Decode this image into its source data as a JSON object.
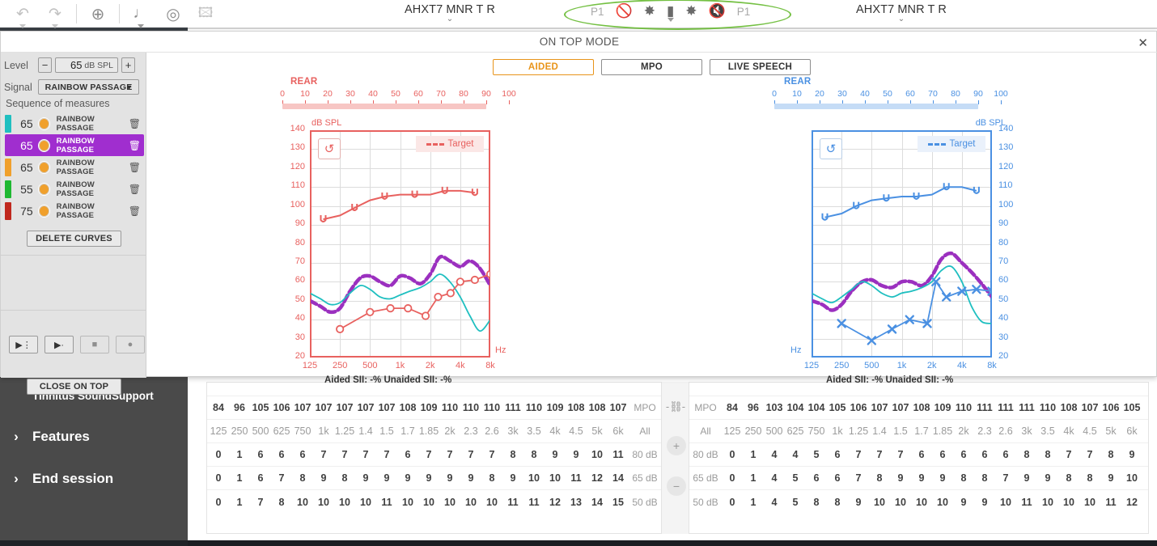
{
  "toolbar": {
    "icons": [
      {
        "name": "undo-icon",
        "glyph": "↶",
        "dim": true,
        "caret": true
      },
      {
        "name": "redo-icon",
        "glyph": "↷",
        "dim": true,
        "caret": true
      },
      {
        "name": "target-icon",
        "glyph": "⊕",
        "dim": false,
        "caret": false
      },
      {
        "name": "music-note-icon",
        "glyph": "♪",
        "dim": false,
        "caret": true
      },
      {
        "name": "spiral-target-icon",
        "glyph": "◎",
        "dim": false,
        "caret": false
      },
      {
        "name": "presenter-icon",
        "glyph": "▣",
        "dim": true,
        "caret": false
      }
    ],
    "device_left": "AHXT7 MNR T R",
    "device_right": "AHXT7 MNR T R",
    "program_left": "P1",
    "program_right": "P1",
    "device_icons": [
      {
        "name": "mute-hearing-aid-icon",
        "glyph": "🚫"
      },
      {
        "name": "hearing-aid-left-icon",
        "glyph": "✲"
      },
      {
        "name": "battery-icon",
        "glyph": "▮"
      },
      {
        "name": "hearing-aid-right-icon",
        "glyph": "✲"
      },
      {
        "name": "mute-speaker-icon",
        "glyph": "🔇"
      }
    ],
    "highlight_color": "#74c043"
  },
  "sidebar": {
    "sub_item": "Tinnitus SoundSupport",
    "items": [
      {
        "label": "Features",
        "chevron": "›"
      },
      {
        "label": "End session",
        "chevron": "›"
      }
    ]
  },
  "ontop": {
    "title": "ON TOP MODE",
    "close_glyph": "✕",
    "controls": {
      "level_label": "Level",
      "level_minus": "−",
      "level_plus": "+",
      "level_value": "65",
      "level_unit": "dB SPL",
      "signal_label": "Signal",
      "signal_value": "RAINBOW PASSAGE",
      "signal_caret": "▼",
      "sequence_title": "Sequence of measures",
      "sequence": [
        {
          "level": "65",
          "name": "RAINBOW PASSAGE",
          "color": "#1fbfc0",
          "active": false,
          "trash": "🗑"
        },
        {
          "level": "65",
          "name": "RAINBOW PASSAGE",
          "color": "#a02ecf",
          "active": true,
          "trash": "🗑"
        },
        {
          "level": "65",
          "name": "RAINBOW PASSAGE",
          "color": "#f0a02c",
          "active": false,
          "trash": "🗑"
        },
        {
          "level": "55",
          "name": "RAINBOW PASSAGE",
          "color": "#1fb832",
          "active": false,
          "trash": "🗑"
        },
        {
          "level": "75",
          "name": "RAINBOW PASSAGE",
          "color": "#c0281e",
          "active": false,
          "trash": "🗑"
        }
      ],
      "delete_curves": "DELETE CURVES",
      "playback": [
        {
          "name": "play-sequence-button",
          "glyph": "▶⋮",
          "dim": false
        },
        {
          "name": "play-button",
          "glyph": "▶·",
          "dim": false
        },
        {
          "name": "stop-button",
          "glyph": "■",
          "dim": true
        },
        {
          "name": "record-button",
          "glyph": "●",
          "dim": true
        }
      ],
      "close_on_top": "CLOSE ON TOP"
    },
    "tabs": [
      {
        "label": "AIDED",
        "selected": true
      },
      {
        "label": "MPO",
        "selected": false
      },
      {
        "label": "LIVE SPEECH",
        "selected": false
      }
    ]
  },
  "chart_data": [
    {
      "id": "left",
      "type": "line",
      "title": "REAR",
      "side": "left",
      "accent": "#e8615f",
      "ylabel": "dB SPL",
      "xlabel": "Hz",
      "ylim": [
        20,
        140
      ],
      "yticks": [
        140,
        130,
        120,
        110,
        100,
        90,
        80,
        70,
        60,
        50,
        40,
        30,
        20
      ],
      "xticks": [
        "125",
        "250",
        "500",
        "1k",
        "2k",
        "4k",
        "8k"
      ],
      "top_scale_ticks": [
        "0",
        "10",
        "20",
        "30",
        "40",
        "50",
        "60",
        "70",
        "80",
        "90",
        "100"
      ],
      "legend": "Target",
      "reset_glyph": "↺",
      "footer": "Aided SII: -%   Unaided SII: -%",
      "aided_sii": "-%",
      "unaided_sii": "-%",
      "series": [
        {
          "name": "MPO",
          "color": "#e8615f",
          "style": "solid-marker",
          "marker": "u",
          "x": [
            170,
            250,
            350,
            500,
            700,
            1000,
            1400,
            2000,
            2800,
            4000,
            5600
          ],
          "y": [
            93,
            95,
            99,
            103,
            105,
            106,
            106,
            106,
            108,
            108,
            107
          ]
        },
        {
          "name": "Aided 65 (purple)",
          "color": "#9b30bf",
          "style": "dashed-thick",
          "x": [
            125,
            160,
            200,
            250,
            315,
            400,
            500,
            630,
            800,
            1000,
            1250,
            1600,
            2000,
            2500,
            3150,
            4000,
            5000,
            6300,
            8000
          ],
          "y": [
            50,
            47,
            44,
            46,
            55,
            62,
            63,
            60,
            58,
            63,
            62,
            59,
            64,
            73,
            71,
            68,
            71,
            67,
            58
          ]
        },
        {
          "name": "Unaided (teal)",
          "color": "#1fbfc0",
          "style": "solid-thin",
          "x": [
            125,
            160,
            200,
            250,
            315,
            400,
            500,
            630,
            800,
            1000,
            1250,
            1600,
            2000,
            2500,
            3150,
            4000,
            5000,
            6300,
            8000
          ],
          "y": [
            54,
            51,
            48,
            49,
            54,
            58,
            56,
            52,
            51,
            53,
            55,
            57,
            60,
            64,
            60,
            52,
            42,
            34,
            40
          ]
        },
        {
          "name": "Target (red circles)",
          "color": "#e8615f",
          "style": "circle-marker",
          "x": [
            250,
            500,
            800,
            1200,
            1800,
            2400,
            3200,
            4000,
            5600,
            8000
          ],
          "y": [
            35,
            44,
            46,
            46,
            42,
            52,
            54,
            60,
            61,
            64
          ]
        }
      ]
    },
    {
      "id": "right",
      "type": "line",
      "title": "REAR",
      "side": "right",
      "accent": "#4a90e2",
      "ylabel": "dB SPL",
      "xlabel": "Hz",
      "ylim": [
        20,
        140
      ],
      "yticks": [
        140,
        130,
        120,
        110,
        100,
        90,
        80,
        70,
        60,
        50,
        40,
        30,
        20
      ],
      "xticks": [
        "125",
        "250",
        "500",
        "1k",
        "2k",
        "4k",
        "8k"
      ],
      "top_scale_ticks": [
        "0",
        "10",
        "20",
        "30",
        "40",
        "50",
        "60",
        "70",
        "80",
        "90",
        "100"
      ],
      "legend": "Target",
      "reset_glyph": "↺",
      "footer": "Aided SII: -%   Unaided SII: -%",
      "aided_sii": "-%",
      "unaided_sii": "-%",
      "series": [
        {
          "name": "MPO",
          "color": "#4a90e2",
          "style": "solid-marker",
          "marker": "u",
          "x": [
            170,
            250,
            350,
            500,
            700,
            1000,
            1400,
            2000,
            2800,
            4000,
            5600
          ],
          "y": [
            94,
            96,
            100,
            103,
            104,
            105,
            105,
            106,
            110,
            110,
            108
          ]
        },
        {
          "name": "Aided 65 (purple)",
          "color": "#9b30bf",
          "style": "dashed-thick",
          "x": [
            125,
            160,
            200,
            250,
            315,
            400,
            500,
            630,
            800,
            1000,
            1250,
            1600,
            2000,
            2500,
            3150,
            4000,
            5000,
            6300,
            8000
          ],
          "y": [
            50,
            48,
            45,
            48,
            55,
            60,
            61,
            58,
            57,
            60,
            60,
            58,
            63,
            72,
            75,
            70,
            65,
            59,
            52
          ]
        },
        {
          "name": "Unaided (teal)",
          "color": "#1fbfc0",
          "style": "solid-thin",
          "x": [
            125,
            160,
            200,
            250,
            315,
            400,
            500,
            630,
            800,
            1000,
            1250,
            1600,
            2000,
            2500,
            3150,
            4000,
            5000,
            6300,
            8000
          ],
          "y": [
            54,
            51,
            49,
            52,
            56,
            60,
            58,
            54,
            52,
            54,
            55,
            57,
            60,
            66,
            68,
            60,
            47,
            39,
            38
          ]
        },
        {
          "name": "Target (blue crosses)",
          "color": "#4a90e2",
          "style": "cross-marker",
          "x": [
            250,
            500,
            800,
            1200,
            1800,
            2200,
            2800,
            4000,
            5600,
            8000
          ],
          "y": [
            38,
            29,
            35,
            40,
            38,
            60,
            52,
            55,
            56,
            55
          ]
        }
      ]
    }
  ],
  "tables": {
    "left": {
      "row_mpo_values": [
        "84",
        "96",
        "105",
        "106",
        "107",
        "107",
        "107",
        "107",
        "107",
        "108",
        "109",
        "110",
        "110",
        "110",
        "111",
        "110",
        "109",
        "108",
        "108",
        "107"
      ],
      "row_mpo_label": "MPO",
      "row_freq_values": [
        "125",
        "250",
        "500",
        "625",
        "750",
        "1k",
        "1.25",
        "1.4",
        "1.5",
        "1.7",
        "1.85",
        "2k",
        "2.3",
        "2.6",
        "3k",
        "3.5",
        "4k",
        "4.5",
        "5k",
        "6k"
      ],
      "row_freq_label": "All",
      "row_80_values": [
        "0",
        "1",
        "6",
        "6",
        "6",
        "7",
        "7",
        "7",
        "7",
        "6",
        "7",
        "7",
        "7",
        "7",
        "8",
        "8",
        "9",
        "9",
        "10",
        "11"
      ],
      "row_80_label": "80 dB",
      "row_65_values": [
        "0",
        "1",
        "6",
        "7",
        "8",
        "9",
        "8",
        "9",
        "9",
        "9",
        "9",
        "9",
        "9",
        "8",
        "9",
        "10",
        "10",
        "11",
        "12",
        "14"
      ],
      "row_65_label": "65 dB",
      "row_50_values": [
        "0",
        "1",
        "7",
        "8",
        "10",
        "10",
        "10",
        "10",
        "11",
        "10",
        "10",
        "10",
        "10",
        "10",
        "11",
        "11",
        "12",
        "13",
        "14",
        "15"
      ],
      "row_50_label": "50 dB"
    },
    "right": {
      "row_mpo_label": "MPO",
      "row_mpo_values": [
        "84",
        "96",
        "103",
        "104",
        "104",
        "105",
        "106",
        "107",
        "107",
        "108",
        "109",
        "110",
        "111",
        "111",
        "111",
        "110",
        "108",
        "107",
        "106",
        "105"
      ],
      "row_freq_label": "All",
      "row_freq_values": [
        "125",
        "250",
        "500",
        "625",
        "750",
        "1k",
        "1.25",
        "1.4",
        "1.5",
        "1.7",
        "1.85",
        "2k",
        "2.3",
        "2.6",
        "3k",
        "3.5",
        "4k",
        "4.5",
        "5k",
        "6k"
      ],
      "row_80_label": "80 dB",
      "row_80_values": [
        "0",
        "1",
        "4",
        "4",
        "5",
        "6",
        "7",
        "7",
        "7",
        "6",
        "6",
        "6",
        "6",
        "6",
        "8",
        "8",
        "7",
        "7",
        "8",
        "9"
      ],
      "row_65_label": "65 dB",
      "row_65_values": [
        "0",
        "1",
        "4",
        "5",
        "6",
        "6",
        "7",
        "8",
        "9",
        "9",
        "9",
        "8",
        "8",
        "7",
        "9",
        "9",
        "8",
        "8",
        "9",
        "10"
      ],
      "row_50_label": "50 dB",
      "row_50_values": [
        "0",
        "1",
        "4",
        "5",
        "8",
        "8",
        "9",
        "10",
        "10",
        "10",
        "10",
        "9",
        "9",
        "10",
        "11",
        "10",
        "10",
        "10",
        "11",
        "12"
      ]
    },
    "link_icon": "⛓",
    "plus": "+",
    "minus": "−"
  }
}
